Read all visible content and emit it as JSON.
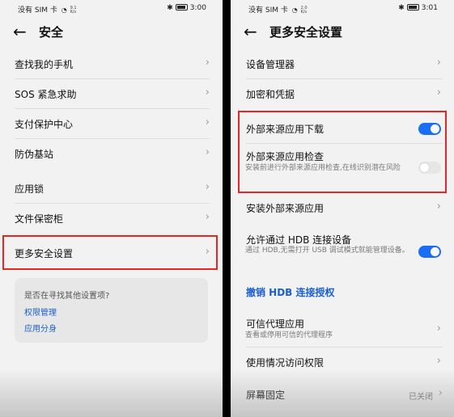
{
  "left": {
    "status": {
      "carrier": "没有 SIM 卡",
      "speed_top": "9.1",
      "speed_unit": "K/s",
      "time": "3:00"
    },
    "title": "安全",
    "items": [
      {
        "label": "查找我的手机"
      },
      {
        "label": "SOS 紧急求助"
      },
      {
        "label": "支付保护中心"
      },
      {
        "label": "防伪基站"
      },
      {
        "label": "应用锁"
      },
      {
        "label": "文件保密柜"
      },
      {
        "label": "更多安全设置"
      }
    ],
    "suggest": {
      "question": "是否在寻找其他设置项?",
      "links": [
        "权限管理",
        "应用分身"
      ]
    }
  },
  "right": {
    "status": {
      "carrier": "没有 SIM 卡",
      "speed_top": "2.0",
      "speed_unit": "K/s",
      "time": "3:01"
    },
    "title": "更多安全设置",
    "items": {
      "device_manager": "设备管理器",
      "encryption": "加密和凭据",
      "external_download": "外部来源应用下载",
      "external_check": "外部来源应用检查",
      "external_check_sub": "安装前进行外部来源应用检查,在线识别潜在风险",
      "install_external": "安装外部来源应用",
      "hdb": "允许通过 HDB 连接设备",
      "hdb_sub": "通过 HDB,无需打开 USB 调试模式就能管理设备。",
      "revoke_hdb": "撤销 HDB 连接授权",
      "trust_agent": "可信代理应用",
      "trust_agent_sub": "查看或停用可信的代理程序",
      "usage_access": "使用情况访问权限",
      "screen_pin": "屏幕固定",
      "screen_pin_status": "已关闭"
    },
    "toggles": {
      "external_download": true,
      "external_check": false,
      "hdb": true
    }
  },
  "colors": {
    "accent": "#1a6ef5",
    "highlight_box": "#e52626",
    "link": "#1a5fd0"
  }
}
